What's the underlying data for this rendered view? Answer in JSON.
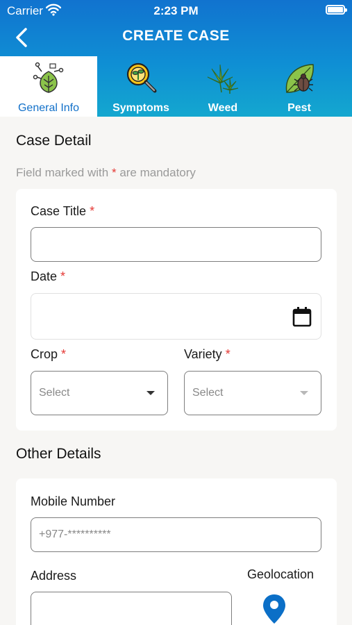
{
  "status_bar": {
    "carrier": "Carrier",
    "time": "2:23 PM"
  },
  "header": {
    "title": "CREATE CASE"
  },
  "tabs": [
    {
      "label": "General Info",
      "icon": "leaf-network-icon",
      "active": true
    },
    {
      "label": "Symptoms",
      "icon": "magnifier-plant-icon",
      "active": false
    },
    {
      "label": "Weed",
      "icon": "weed-icon",
      "active": false
    },
    {
      "label": "Pest",
      "icon": "beetle-leaf-icon",
      "active": false
    }
  ],
  "case_detail": {
    "heading": "Case Detail",
    "mandatory_note_prefix": "Field marked with",
    "mandatory_star": "*",
    "mandatory_note_suffix": "are mandatory",
    "case_title": {
      "label": "Case Title",
      "value": ""
    },
    "date": {
      "label": "Date",
      "value": ""
    },
    "crop": {
      "label": "Crop",
      "placeholder": "Select"
    },
    "variety": {
      "label": "Variety",
      "placeholder": "Select"
    }
  },
  "other_details": {
    "heading": "Other Details",
    "mobile_number": {
      "label": "Mobile Number",
      "placeholder": "+977-**********"
    },
    "address": {
      "label": "Address",
      "value": ""
    },
    "geolocation": {
      "label": "Geolocation"
    }
  },
  "colors": {
    "header_gradient_top": "#1173cf",
    "header_gradient_bottom": "#14a7cf",
    "active_tab_text": "#1170c9",
    "required_star": "#e53935",
    "pin": "#0b6fc7"
  }
}
